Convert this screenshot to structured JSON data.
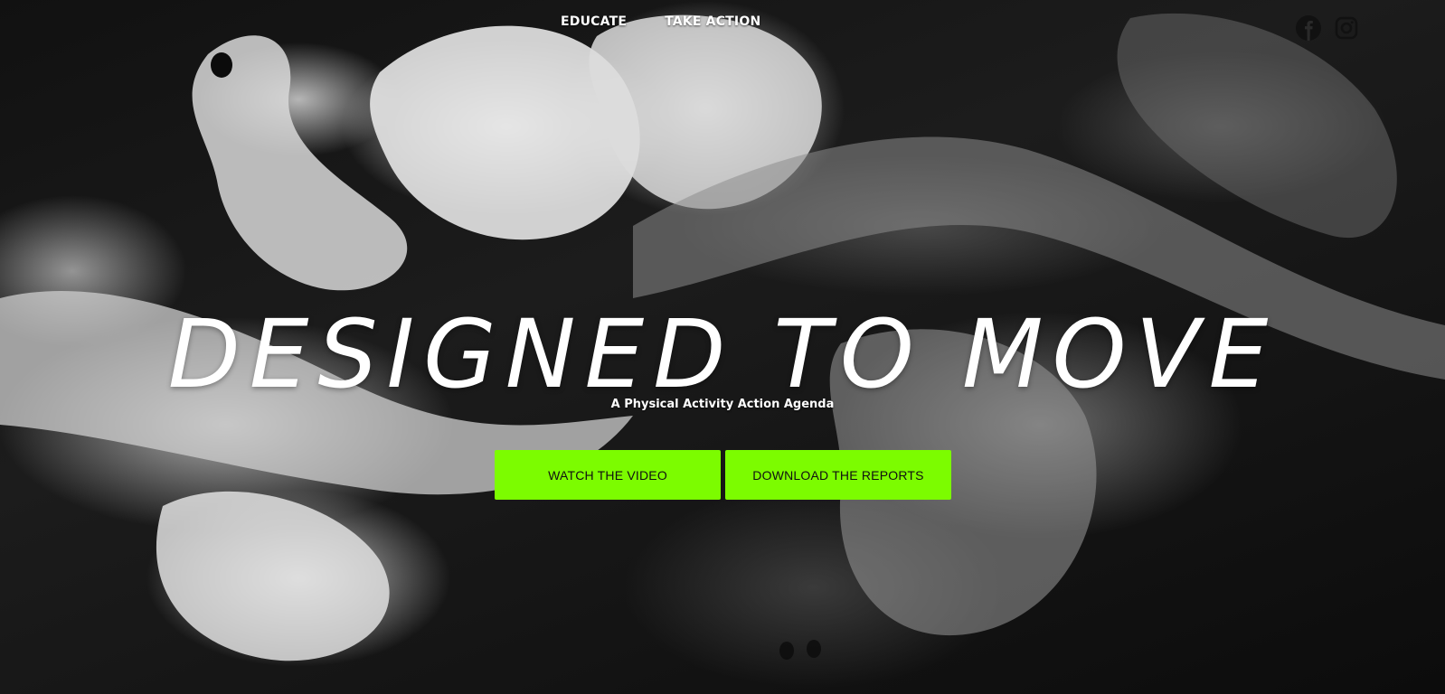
{
  "nav": {
    "items": [
      {
        "label": "EDUCATE"
      },
      {
        "label": "TAKE ACTION"
      }
    ]
  },
  "social": {
    "icons": [
      "facebook-icon",
      "instagram-icon"
    ]
  },
  "hero": {
    "headline": "DESIGNED TO MOVE",
    "subtitle": "A Physical Activity Action Agenda",
    "buttons": [
      {
        "label": "WATCH THE VIDEO"
      },
      {
        "label": "DOWNLOAD THE REPORTS"
      }
    ]
  },
  "colors": {
    "accent": "#7cfc00",
    "text": "#ffffff",
    "background": "#111111"
  }
}
